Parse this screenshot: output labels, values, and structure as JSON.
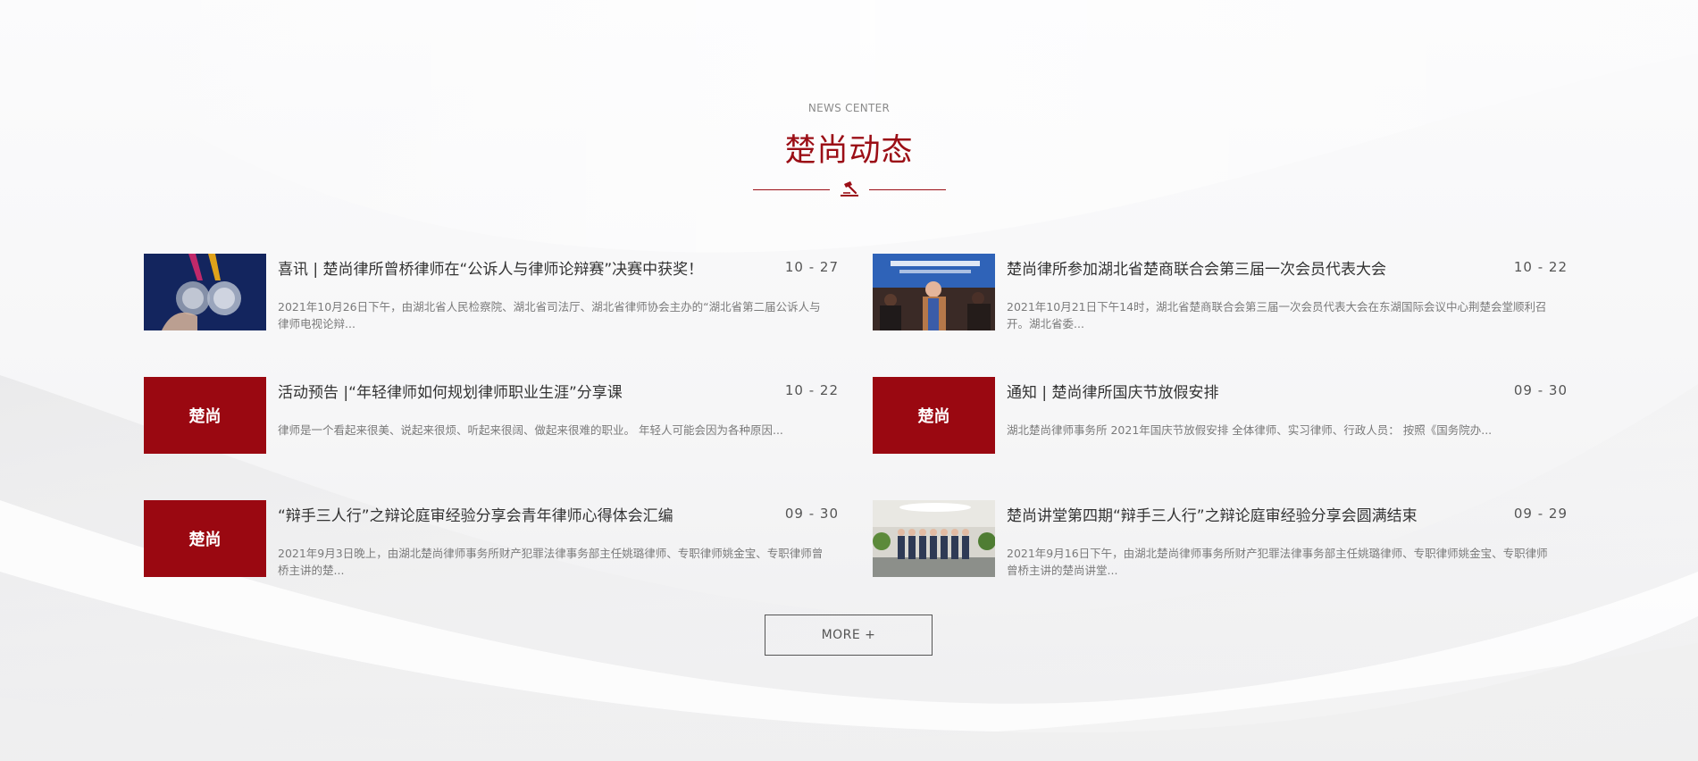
{
  "header": {
    "subtitle": "NEWS CENTER",
    "title": "楚尚动态"
  },
  "brand": {
    "thumb_label": "楚尚",
    "accent_color": "#9b0e16"
  },
  "news": [
    {
      "title": "喜讯 | 楚尚律所曾桥律师在“公诉人与律师论辩赛”决赛中获奖！",
      "date": "10 - 27",
      "desc": "2021年10月26日下午，由湖北省人民检察院、湖北省司法厅、湖北省律师协会主办的“湖北省第二届公诉人与律师电视论辩...",
      "thumb": "medals-photo"
    },
    {
      "title": "楚尚律所参加湖北省楚商联合会第三届一次会员代表大会",
      "date": "10 - 22",
      "desc": "2021年10月21日下午14时，湖北省楚商联合会第三届一次会员代表大会在东湖国际会议中心荆楚会堂顺利召开。湖北省委...",
      "thumb": "conference-photo"
    },
    {
      "title": "活动预告 |“年轻律师如何规划律师职业生涯”分享课",
      "date": "10 - 22",
      "desc": "律师是一个看起来很美、说起来很烦、听起来很阔、做起来很难的职业。 年轻人可能会因为各种原因...",
      "thumb": "brand"
    },
    {
      "title": "通知 | 楚尚律所国庆节放假安排",
      "date": "09 - 30",
      "desc": "湖北楚尚律师事务所 2021年国庆节放假安排 全体律师、实习律师、行政人员： 按照《国务院办...",
      "thumb": "brand"
    },
    {
      "title": "“辩手三人行”之辩论庭审经验分享会青年律师心得体会汇编",
      "date": "09 - 30",
      "desc": "2021年9月3日晚上，由湖北楚尚律师事务所财产犯罪法律事务部主任姚璐律师、专职律师姚金宝、专职律师曾桥主讲的楚...",
      "thumb": "brand"
    },
    {
      "title": "楚尚讲堂第四期“辩手三人行”之辩论庭审经验分享会圆满结束",
      "date": "09 - 29",
      "desc": "2021年9月16日下午，由湖北楚尚律师事务所财产犯罪法律事务部主任姚璐律师、专职律师姚金宝、专职律师曾桥主讲的楚尚讲堂...",
      "thumb": "group-photo"
    }
  ],
  "more_button": {
    "label": "MORE +"
  }
}
